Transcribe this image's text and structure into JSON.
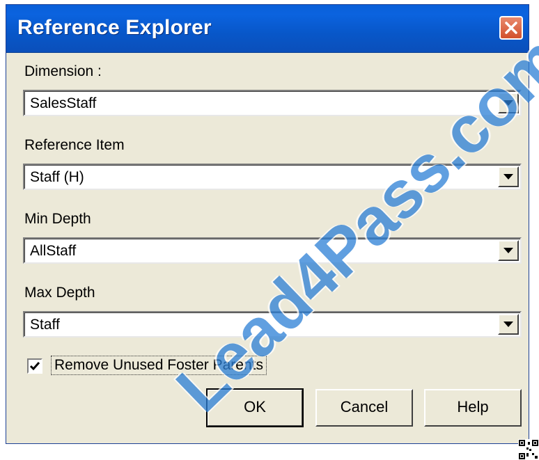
{
  "window": {
    "title": "Reference Explorer"
  },
  "fields": [
    {
      "label": "Dimension :",
      "value": "SalesStaff"
    },
    {
      "label": "Reference Item",
      "value": "Staff (H)"
    },
    {
      "label": "Min Depth",
      "value": "AllStaff"
    },
    {
      "label": "Max Depth",
      "value": "Staff"
    }
  ],
  "checkbox": {
    "label": "Remove Unused Foster Parents",
    "checked": true
  },
  "buttons": {
    "ok": "OK",
    "cancel": "Cancel",
    "help": "Help"
  },
  "watermark": {
    "text": "Lead4Pass.com"
  },
  "colors": {
    "titlebar": "#0b63df",
    "dialog_bg": "#ece9d8",
    "watermark": "#2b7fd6",
    "close": "#d2502c"
  },
  "icons": [
    "close-icon",
    "chevron-down-icon",
    "checkmark-icon",
    "qr-code-icon"
  ]
}
